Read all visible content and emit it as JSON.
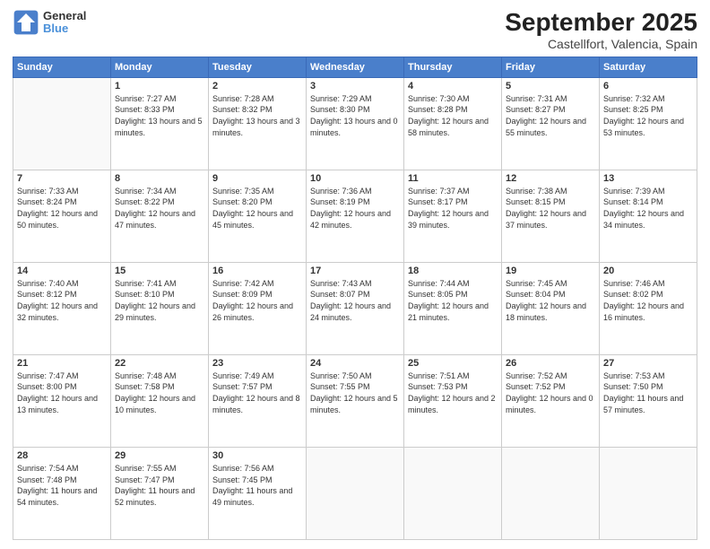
{
  "logo": {
    "line1": "General",
    "line2": "Blue"
  },
  "title": "September 2025",
  "subtitle": "Castellfort, Valencia, Spain",
  "days_of_week": [
    "Sunday",
    "Monday",
    "Tuesday",
    "Wednesday",
    "Thursday",
    "Friday",
    "Saturday"
  ],
  "weeks": [
    [
      {
        "day": "",
        "sunrise": "",
        "sunset": "",
        "daylight": "",
        "empty": true
      },
      {
        "day": "1",
        "sunrise": "Sunrise: 7:27 AM",
        "sunset": "Sunset: 8:33 PM",
        "daylight": "Daylight: 13 hours and 5 minutes."
      },
      {
        "day": "2",
        "sunrise": "Sunrise: 7:28 AM",
        "sunset": "Sunset: 8:32 PM",
        "daylight": "Daylight: 13 hours and 3 minutes."
      },
      {
        "day": "3",
        "sunrise": "Sunrise: 7:29 AM",
        "sunset": "Sunset: 8:30 PM",
        "daylight": "Daylight: 13 hours and 0 minutes."
      },
      {
        "day": "4",
        "sunrise": "Sunrise: 7:30 AM",
        "sunset": "Sunset: 8:28 PM",
        "daylight": "Daylight: 12 hours and 58 minutes."
      },
      {
        "day": "5",
        "sunrise": "Sunrise: 7:31 AM",
        "sunset": "Sunset: 8:27 PM",
        "daylight": "Daylight: 12 hours and 55 minutes."
      },
      {
        "day": "6",
        "sunrise": "Sunrise: 7:32 AM",
        "sunset": "Sunset: 8:25 PM",
        "daylight": "Daylight: 12 hours and 53 minutes."
      }
    ],
    [
      {
        "day": "7",
        "sunrise": "Sunrise: 7:33 AM",
        "sunset": "Sunset: 8:24 PM",
        "daylight": "Daylight: 12 hours and 50 minutes."
      },
      {
        "day": "8",
        "sunrise": "Sunrise: 7:34 AM",
        "sunset": "Sunset: 8:22 PM",
        "daylight": "Daylight: 12 hours and 47 minutes."
      },
      {
        "day": "9",
        "sunrise": "Sunrise: 7:35 AM",
        "sunset": "Sunset: 8:20 PM",
        "daylight": "Daylight: 12 hours and 45 minutes."
      },
      {
        "day": "10",
        "sunrise": "Sunrise: 7:36 AM",
        "sunset": "Sunset: 8:19 PM",
        "daylight": "Daylight: 12 hours and 42 minutes."
      },
      {
        "day": "11",
        "sunrise": "Sunrise: 7:37 AM",
        "sunset": "Sunset: 8:17 PM",
        "daylight": "Daylight: 12 hours and 39 minutes."
      },
      {
        "day": "12",
        "sunrise": "Sunrise: 7:38 AM",
        "sunset": "Sunset: 8:15 PM",
        "daylight": "Daylight: 12 hours and 37 minutes."
      },
      {
        "day": "13",
        "sunrise": "Sunrise: 7:39 AM",
        "sunset": "Sunset: 8:14 PM",
        "daylight": "Daylight: 12 hours and 34 minutes."
      }
    ],
    [
      {
        "day": "14",
        "sunrise": "Sunrise: 7:40 AM",
        "sunset": "Sunset: 8:12 PM",
        "daylight": "Daylight: 12 hours and 32 minutes."
      },
      {
        "day": "15",
        "sunrise": "Sunrise: 7:41 AM",
        "sunset": "Sunset: 8:10 PM",
        "daylight": "Daylight: 12 hours and 29 minutes."
      },
      {
        "day": "16",
        "sunrise": "Sunrise: 7:42 AM",
        "sunset": "Sunset: 8:09 PM",
        "daylight": "Daylight: 12 hours and 26 minutes."
      },
      {
        "day": "17",
        "sunrise": "Sunrise: 7:43 AM",
        "sunset": "Sunset: 8:07 PM",
        "daylight": "Daylight: 12 hours and 24 minutes."
      },
      {
        "day": "18",
        "sunrise": "Sunrise: 7:44 AM",
        "sunset": "Sunset: 8:05 PM",
        "daylight": "Daylight: 12 hours and 21 minutes."
      },
      {
        "day": "19",
        "sunrise": "Sunrise: 7:45 AM",
        "sunset": "Sunset: 8:04 PM",
        "daylight": "Daylight: 12 hours and 18 minutes."
      },
      {
        "day": "20",
        "sunrise": "Sunrise: 7:46 AM",
        "sunset": "Sunset: 8:02 PM",
        "daylight": "Daylight: 12 hours and 16 minutes."
      }
    ],
    [
      {
        "day": "21",
        "sunrise": "Sunrise: 7:47 AM",
        "sunset": "Sunset: 8:00 PM",
        "daylight": "Daylight: 12 hours and 13 minutes."
      },
      {
        "day": "22",
        "sunrise": "Sunrise: 7:48 AM",
        "sunset": "Sunset: 7:58 PM",
        "daylight": "Daylight: 12 hours and 10 minutes."
      },
      {
        "day": "23",
        "sunrise": "Sunrise: 7:49 AM",
        "sunset": "Sunset: 7:57 PM",
        "daylight": "Daylight: 12 hours and 8 minutes."
      },
      {
        "day": "24",
        "sunrise": "Sunrise: 7:50 AM",
        "sunset": "Sunset: 7:55 PM",
        "daylight": "Daylight: 12 hours and 5 minutes."
      },
      {
        "day": "25",
        "sunrise": "Sunrise: 7:51 AM",
        "sunset": "Sunset: 7:53 PM",
        "daylight": "Daylight: 12 hours and 2 minutes."
      },
      {
        "day": "26",
        "sunrise": "Sunrise: 7:52 AM",
        "sunset": "Sunset: 7:52 PM",
        "daylight": "Daylight: 12 hours and 0 minutes."
      },
      {
        "day": "27",
        "sunrise": "Sunrise: 7:53 AM",
        "sunset": "Sunset: 7:50 PM",
        "daylight": "Daylight: 11 hours and 57 minutes."
      }
    ],
    [
      {
        "day": "28",
        "sunrise": "Sunrise: 7:54 AM",
        "sunset": "Sunset: 7:48 PM",
        "daylight": "Daylight: 11 hours and 54 minutes."
      },
      {
        "day": "29",
        "sunrise": "Sunrise: 7:55 AM",
        "sunset": "Sunset: 7:47 PM",
        "daylight": "Daylight: 11 hours and 52 minutes."
      },
      {
        "day": "30",
        "sunrise": "Sunrise: 7:56 AM",
        "sunset": "Sunset: 7:45 PM",
        "daylight": "Daylight: 11 hours and 49 minutes."
      },
      {
        "day": "",
        "sunrise": "",
        "sunset": "",
        "daylight": "",
        "empty": true
      },
      {
        "day": "",
        "sunrise": "",
        "sunset": "",
        "daylight": "",
        "empty": true
      },
      {
        "day": "",
        "sunrise": "",
        "sunset": "",
        "daylight": "",
        "empty": true
      },
      {
        "day": "",
        "sunrise": "",
        "sunset": "",
        "daylight": "",
        "empty": true
      }
    ]
  ]
}
